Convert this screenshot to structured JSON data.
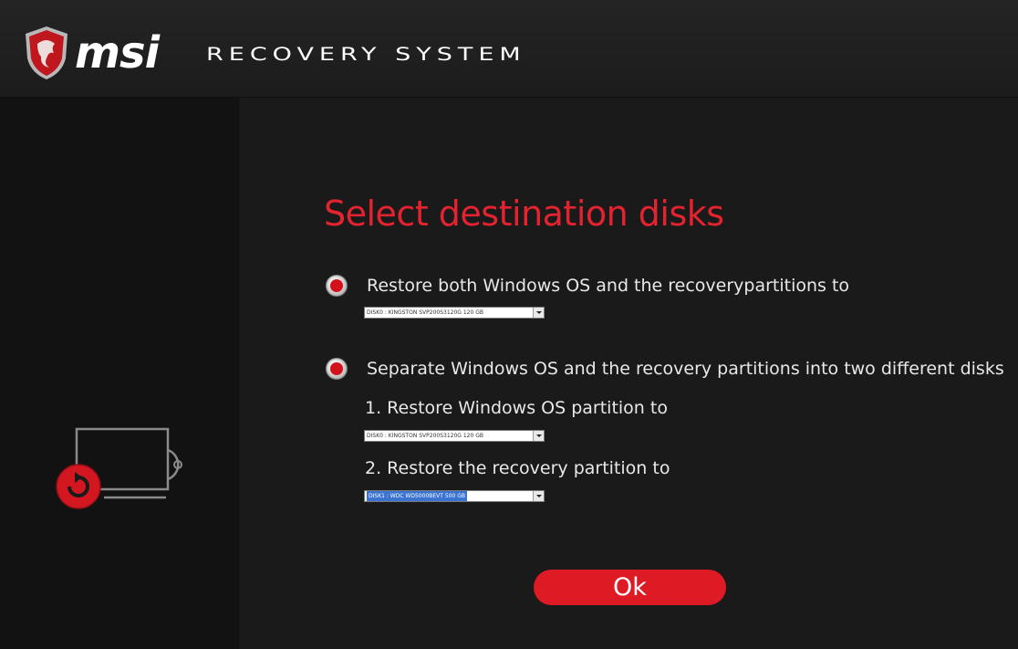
{
  "header": {
    "brand_text": "msi",
    "app_title": "RECOVERY SYSTEM"
  },
  "colors": {
    "accent": "#de1a24",
    "heading": "#e3232f",
    "background": "#181818"
  },
  "main": {
    "heading": "Select destination disks",
    "option_both": {
      "label": "Restore both Windows OS and the recoverypartitions to",
      "disk": "DISK0 : KINGSTON SVP200S3120G 120 GB"
    },
    "option_separate": {
      "label": "Separate Windows OS and the recovery partitions into two different disks",
      "os_label": "1. Restore Windows OS partition to",
      "os_disk": "DISK0 : KINGSTON SVP200S3120G 120 GB",
      "recovery_label": "2. Restore the recovery partition to",
      "recovery_disk": "DISK1 : WDC WD5000BEVT 500 GB"
    },
    "ok_label": "Ok"
  },
  "icons": {
    "logo": "dragon-shield-icon",
    "sidebar": "monitor-recovery-icon"
  }
}
